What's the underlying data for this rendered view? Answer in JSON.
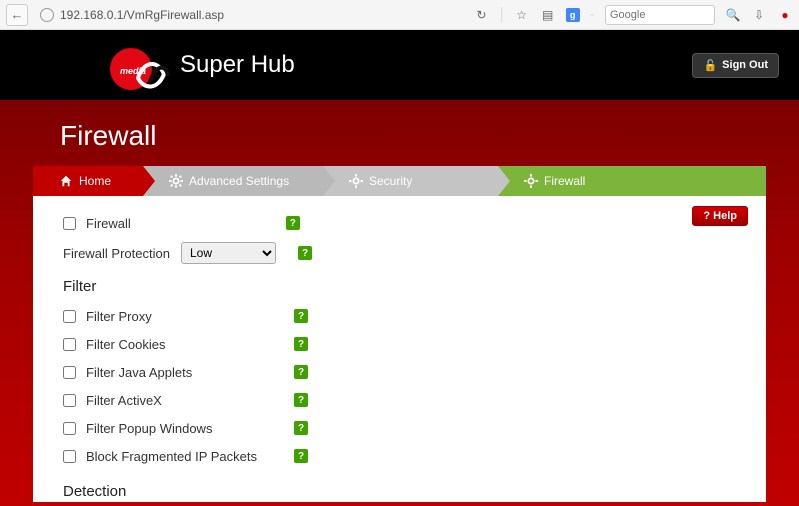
{
  "browser": {
    "url": "192.168.0.1/VmRgFirewall.asp",
    "search_placeholder": "Google"
  },
  "header": {
    "brand": "Super Hub",
    "logo_text": "media",
    "signout": "Sign Out"
  },
  "page": {
    "title": "Firewall",
    "help": "? Help"
  },
  "crumb": {
    "home": "Home",
    "advanced": "Advanced Settings",
    "security": "Security",
    "firewall": "Firewall"
  },
  "firewall": {
    "label": "Firewall",
    "protection_label": "Firewall Protection",
    "protection_value": "Low"
  },
  "sections": {
    "filter": "Filter",
    "detection": "Detection"
  },
  "filters": [
    {
      "label": "Filter Proxy"
    },
    {
      "label": "Filter Cookies"
    },
    {
      "label": "Filter Java Applets"
    },
    {
      "label": "Filter ActiveX"
    },
    {
      "label": "Filter Popup Windows"
    },
    {
      "label": "Block Fragmented IP Packets"
    }
  ]
}
